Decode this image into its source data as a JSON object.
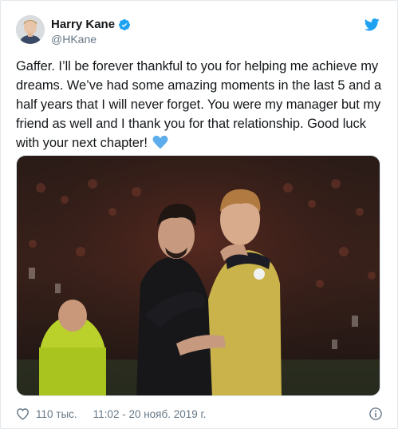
{
  "user": {
    "name": "Harry Kane",
    "handle": "@HKane"
  },
  "tweet": {
    "text": "Gaffer. I’ll be forever thankful to you for helping me achieve my dreams. We’ve had some amazing moments in the last 5 and a half years that I will never forget. You were my manager but my friend as well and I thank you for that relationship. Good luck with your next chapter!"
  },
  "footer": {
    "likes": "110 тыс.",
    "timestamp": "11:02 - 20 нояб. 2019 г."
  },
  "icons": {
    "verified": "verified-badge-icon",
    "bird": "twitter-bird-icon",
    "heart_emoji": "blue-heart-emoji",
    "like": "heart-outline-icon",
    "info": "info-circle-icon"
  },
  "colors": {
    "twitter_blue": "#1da1f2",
    "text": "#14171a",
    "muted": "#657786",
    "emoji_blue": "#5dadec"
  }
}
